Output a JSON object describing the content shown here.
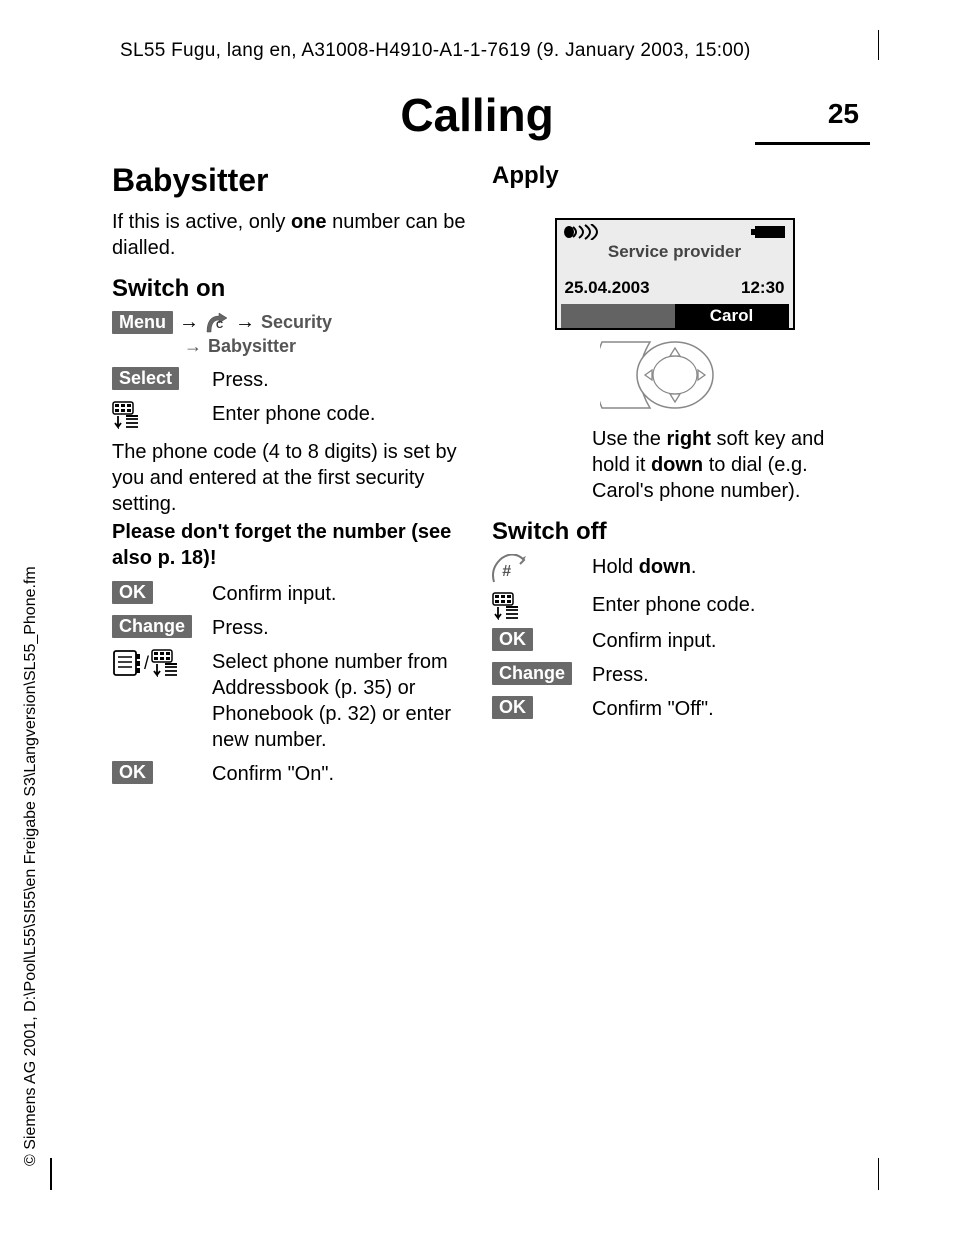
{
  "header": "SL55 Fugu, lang en, A31008-H4910-A1-1-7619 (9. January 2003, 15:00)",
  "page_title": "Calling",
  "page_number": "25",
  "left": {
    "h1": "Babysitter",
    "intro_a": "If this is active, only ",
    "intro_bold": "one",
    "intro_b": " number can be dialled.",
    "switch_on": "Switch on",
    "menu": "Menu",
    "security": "Security",
    "babysitter": "Babysitter",
    "select": "Select",
    "press": "Press.",
    "enter_code": "Enter phone code.",
    "code_note": "The phone code (4 to 8 digits) is set by you and entered at the first security setting.",
    "dont_forget": "Please don't forget the number (see also p. 18)!",
    "ok": "OK",
    "confirm_input": "Confirm input.",
    "change": "Change",
    "select_num": "Select phone number from Addressbook (p. 35) or Phonebook (p. 32) or enter new number.",
    "confirm_on": "Confirm \"On\"."
  },
  "right": {
    "apply": "Apply",
    "provider": "Service provider",
    "date": "25.04.2003",
    "time": "12:30",
    "softkey": "Carol",
    "apply_note_a": "Use the ",
    "apply_note_b": "right",
    "apply_note_c": " soft key and hold it ",
    "apply_note_d": "down",
    "apply_note_e": " to dial (e.g. Carol's phone number).",
    "switch_off": "Switch off",
    "hold_a": "Hold ",
    "hold_b": "down",
    "hold_c": ".",
    "enter_code": "Enter phone code.",
    "ok": "OK",
    "confirm_input": "Confirm input.",
    "change": "Change",
    "press": "Press.",
    "confirm_off": "Confirm \"Off\"."
  },
  "copyright": "© Siemens AG 2001, D:\\Pool\\L55\\SI55\\en Freigabe S3\\Langversion\\SL55_Phone.fm"
}
